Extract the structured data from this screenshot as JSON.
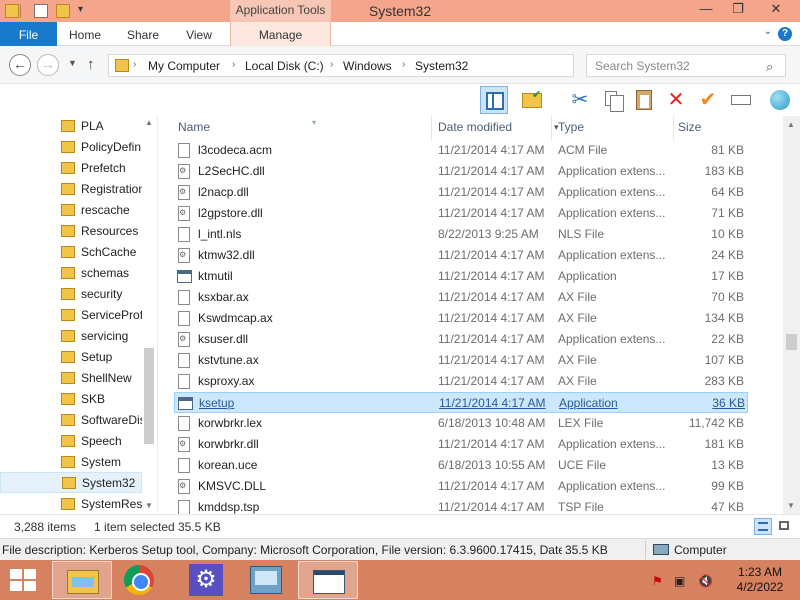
{
  "window": {
    "title": "System32",
    "context_tab_header": "Application Tools",
    "minimize": "—",
    "maximize": "❐",
    "close": "✕"
  },
  "ribbon": {
    "tabs": [
      "File",
      "Home",
      "Share",
      "View",
      "Manage"
    ],
    "help": "?"
  },
  "address": {
    "breadcrumbs": [
      "My Computer",
      "Local Disk (C:)",
      "Windows",
      "System32"
    ],
    "search_placeholder": "Search System32"
  },
  "nav_pane": {
    "items": [
      "PLA",
      "PolicyDefin",
      "Prefetch",
      "Registration",
      "rescache",
      "Resources",
      "SchCache",
      "schemas",
      "security",
      "ServiceProf",
      "servicing",
      "Setup",
      "ShellNew",
      "SKB",
      "SoftwareDis",
      "Speech",
      "System",
      "System32",
      "SystemReso"
    ],
    "selected": "System32"
  },
  "columns": {
    "name": "Name",
    "date": "Date modified",
    "type": "Type",
    "size": "Size"
  },
  "files": [
    {
      "name": "l3codeca.acm",
      "date": "11/21/2014 4:17 AM",
      "type": "ACM File",
      "size": "81 KB",
      "icon": "file"
    },
    {
      "name": "L2SecHC.dll",
      "date": "11/21/2014 4:17 AM",
      "type": "Application extens...",
      "size": "183 KB",
      "icon": "dll"
    },
    {
      "name": "l2nacp.dll",
      "date": "11/21/2014 4:17 AM",
      "type": "Application extens...",
      "size": "64 KB",
      "icon": "dll"
    },
    {
      "name": "l2gpstore.dll",
      "date": "11/21/2014 4:17 AM",
      "type": "Application extens...",
      "size": "71 KB",
      "icon": "dll"
    },
    {
      "name": "l_intl.nls",
      "date": "8/22/2013 9:25 AM",
      "type": "NLS File",
      "size": "10 KB",
      "icon": "file"
    },
    {
      "name": "ktmw32.dll",
      "date": "11/21/2014 4:17 AM",
      "type": "Application extens...",
      "size": "24 KB",
      "icon": "dll"
    },
    {
      "name": "ktmutil",
      "date": "11/21/2014 4:17 AM",
      "type": "Application",
      "size": "17 KB",
      "icon": "exe"
    },
    {
      "name": "ksxbar.ax",
      "date": "11/21/2014 4:17 AM",
      "type": "AX File",
      "size": "70 KB",
      "icon": "file"
    },
    {
      "name": "Kswdmcap.ax",
      "date": "11/21/2014 4:17 AM",
      "type": "AX File",
      "size": "134 KB",
      "icon": "file"
    },
    {
      "name": "ksuser.dll",
      "date": "11/21/2014 4:17 AM",
      "type": "Application extens...",
      "size": "22 KB",
      "icon": "dll"
    },
    {
      "name": "kstvtune.ax",
      "date": "11/21/2014 4:17 AM",
      "type": "AX File",
      "size": "107 KB",
      "icon": "file"
    },
    {
      "name": "ksproxy.ax",
      "date": "11/21/2014 4:17 AM",
      "type": "AX File",
      "size": "283 KB",
      "icon": "file"
    },
    {
      "name": "ksetup",
      "date": "11/21/2014 4:17 AM",
      "type": "Application",
      "size": "36 KB",
      "icon": "exe",
      "selected": true
    },
    {
      "name": "korwbrkr.lex",
      "date": "6/18/2013 10:48 AM",
      "type": "LEX File",
      "size": "11,742 KB",
      "icon": "file"
    },
    {
      "name": "korwbrkr.dll",
      "date": "11/21/2014 4:17 AM",
      "type": "Application extens...",
      "size": "181 KB",
      "icon": "dll"
    },
    {
      "name": "korean.uce",
      "date": "6/18/2013 10:55 AM",
      "type": "UCE File",
      "size": "13 KB",
      "icon": "file"
    },
    {
      "name": "KMSVC.DLL",
      "date": "11/21/2014 4:17 AM",
      "type": "Application extens...",
      "size": "99 KB",
      "icon": "dll"
    },
    {
      "name": "kmddsp.tsp",
      "date": "11/21/2014 4:17 AM",
      "type": "TSP File",
      "size": "47 KB",
      "icon": "file"
    }
  ],
  "status": {
    "item_count": "3,288 items",
    "selection": "1 item selected",
    "selection_size": "35.5 KB"
  },
  "details": {
    "description": "File description: Kerberos Setup tool, Company: Microsoft Corporation, File version: 6.3.9600.17415, Date cr",
    "size": "35.5 KB",
    "location": "Computer"
  },
  "taskbar": {
    "time": "1:23 AM",
    "date": "4/2/2022"
  },
  "colors": {
    "titlebar": "#f4a58c",
    "file_tab": "#1979ca",
    "taskbar": "#d68260",
    "selection": "#cce8ff"
  }
}
